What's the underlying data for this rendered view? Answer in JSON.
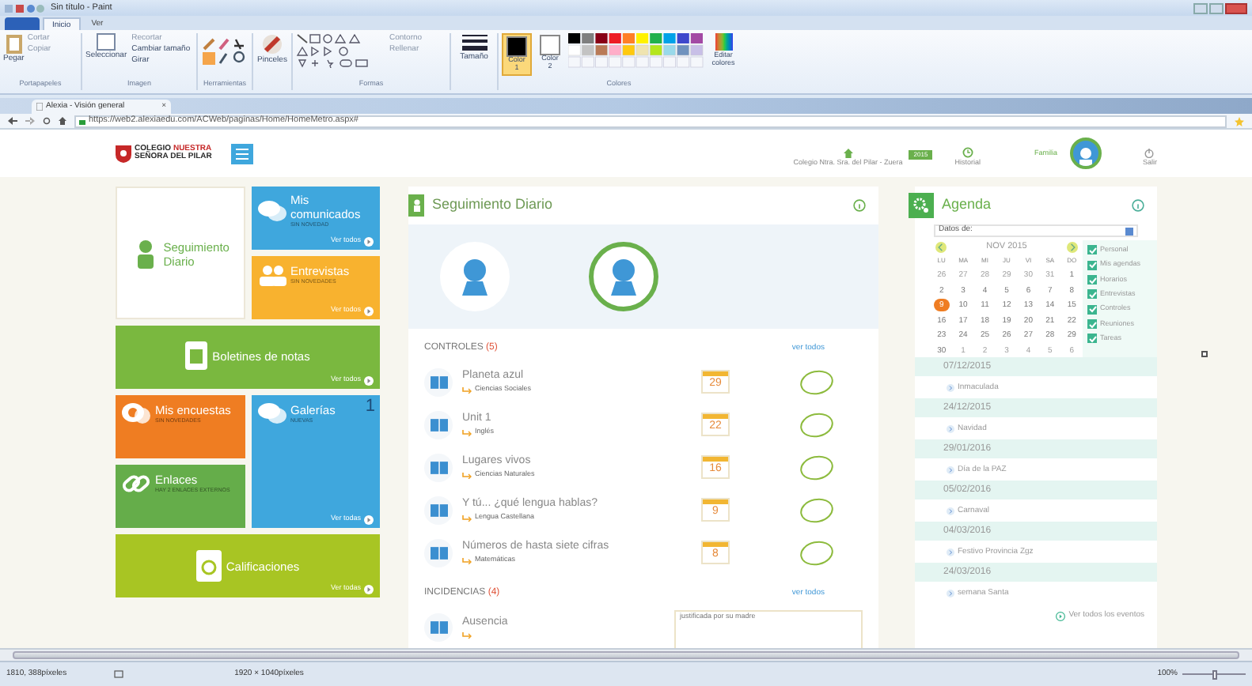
{
  "paint": {
    "title": "Sin título - Paint",
    "tabs": [
      {
        "label": "Inicio",
        "selected": true
      },
      {
        "label": "Ver",
        "selected": false
      }
    ],
    "ribbon": {
      "clipboard": {
        "paste": "Pegar",
        "cut": "Cortar",
        "copy": "Copiar",
        "label": "Portapapeles"
      },
      "image": {
        "select": "Seleccionar",
        "crop": "Recortar",
        "resize": "Cambiar tamaño",
        "rotate": "Girar",
        "label": "Imagen"
      },
      "tools": {
        "label": "Herramientas"
      },
      "brushes": "Pinceles",
      "shapes": {
        "outline": "Contorno",
        "fill": "Rellenar",
        "label": "Formas"
      },
      "size": "Tamaño",
      "colors": {
        "slots": [
          {
            "label": "Color 1",
            "selected": true,
            "color": "#000000"
          },
          {
            "label": "Color 2",
            "selected": false,
            "color": "#ffffff"
          }
        ],
        "edit": "Editar colores",
        "label": "Colores"
      }
    }
  },
  "browser": {
    "tab": {
      "title": "Alexia - Visión general",
      "close": "×"
    },
    "url": "https://web2.alexiaedu.com/ACWeb/paginas/Home/HomeMetro.aspx#"
  },
  "site": {
    "logo": {
      "line1": "COLEGIO",
      "accent": "NUESTRA",
      "line2": "SEÑORA DEL PILAR"
    },
    "header": {
      "school": "Colegio Ntra. Sra. del Pilar - Zuera",
      "year": "2015",
      "history": "Historial",
      "family": "Familia",
      "logout": "Salir"
    }
  },
  "tiles": [
    {
      "kind": "person",
      "title": "Seguimiento Diario",
      "color": "#ffffff"
    },
    {
      "kind": "chat",
      "title": "Mis comunicados",
      "subtitle": "SIN NOVEDAD",
      "link": "Ver todos",
      "color": "#3fa7dd"
    },
    {
      "kind": "people",
      "title": "Entrevistas",
      "subtitle": "SIN NOVEDADES",
      "link": "Ver todos",
      "color": "#f8b22f"
    },
    {
      "kind": "document",
      "title": "Boletines de notas",
      "link": "Ver todos",
      "color": "#7ab83f"
    },
    {
      "kind": "survey",
      "title": "Mis encuestas",
      "subtitle": "SIN NOVEDADES",
      "color": "#ef7d22"
    },
    {
      "kind": "chat",
      "title": "Galerías",
      "subtitle": "NUEVAS",
      "badge": "1",
      "link": "Ver todas",
      "color": "#3fa7dd"
    },
    {
      "kind": "link",
      "title": "Enlaces",
      "subtitle": "HAY 2 ENLACES EXTERNOS",
      "color": "#65ad4a"
    },
    {
      "kind": "certificate",
      "title": "Calificaciones",
      "link": "Ver todas",
      "color": "#a8c523"
    }
  ],
  "seguimiento": {
    "title": "Seguimiento Diario",
    "students": [
      {
        "selected": false
      },
      {
        "selected": true
      }
    ],
    "controles": {
      "title": "CONTROLES",
      "count": "(5)",
      "link": "ver todos",
      "rows": [
        {
          "title": "Planeta azul",
          "subject": "Ciencias Sociales",
          "day": "29"
        },
        {
          "title": "Unit 1",
          "subject": "Inglés",
          "day": "22"
        },
        {
          "title": "Lugares vivos",
          "subject": "Ciencias Naturales",
          "day": "16"
        },
        {
          "title": "Y tú... ¿qué lengua hablas?",
          "subject": "Lengua Castellana",
          "day": "9"
        },
        {
          "title": "Números de hasta siete cifras",
          "subject": "Matemáticas",
          "day": "8"
        }
      ]
    },
    "incidencias": {
      "title": "INCIDENCIAS",
      "count": "(4)",
      "link": "ver todos",
      "rows": [
        {
          "title": "Ausencia",
          "note": "justificada por su madre"
        }
      ]
    }
  },
  "agenda": {
    "title": "Agenda",
    "select": "Datos de:",
    "month": "NOV 2015",
    "weekdays": [
      "LU",
      "MA",
      "MI",
      "JU",
      "VI",
      "SA",
      "DO"
    ],
    "days": [
      {
        "label": "26",
        "in_month": false,
        "selected": false
      },
      {
        "label": "27",
        "in_month": false,
        "selected": false
      },
      {
        "label": "28",
        "in_month": false,
        "selected": false
      },
      {
        "label": "29",
        "in_month": false,
        "selected": false
      },
      {
        "label": "30",
        "in_month": false,
        "selected": false
      },
      {
        "label": "31",
        "in_month": false,
        "selected": false
      },
      {
        "label": "1",
        "in_month": true,
        "selected": false
      },
      {
        "label": "2",
        "in_month": true,
        "selected": false
      },
      {
        "label": "3",
        "in_month": true,
        "selected": false
      },
      {
        "label": "4",
        "in_month": true,
        "selected": false
      },
      {
        "label": "5",
        "in_month": true,
        "selected": false
      },
      {
        "label": "6",
        "in_month": true,
        "selected": false
      },
      {
        "label": "7",
        "in_month": true,
        "selected": false
      },
      {
        "label": "8",
        "in_month": true,
        "selected": false
      },
      {
        "label": "9",
        "in_month": true,
        "selected": true
      },
      {
        "label": "10",
        "in_month": true,
        "selected": false
      },
      {
        "label": "11",
        "in_month": true,
        "selected": false
      },
      {
        "label": "12",
        "in_month": true,
        "selected": false
      },
      {
        "label": "13",
        "in_month": true,
        "selected": false
      },
      {
        "label": "14",
        "in_month": true,
        "selected": false
      },
      {
        "label": "15",
        "in_month": true,
        "selected": false
      },
      {
        "label": "16",
        "in_month": true,
        "selected": false
      },
      {
        "label": "17",
        "in_month": true,
        "selected": false
      },
      {
        "label": "18",
        "in_month": true,
        "selected": false
      },
      {
        "label": "19",
        "in_month": true,
        "selected": false
      },
      {
        "label": "20",
        "in_month": true,
        "selected": false
      },
      {
        "label": "21",
        "in_month": true,
        "selected": false
      },
      {
        "label": "22",
        "in_month": true,
        "selected": false
      },
      {
        "label": "23",
        "in_month": true,
        "selected": false
      },
      {
        "label": "24",
        "in_month": true,
        "selected": false
      },
      {
        "label": "25",
        "in_month": true,
        "selected": false
      },
      {
        "label": "26",
        "in_month": true,
        "selected": false
      },
      {
        "label": "27",
        "in_month": true,
        "selected": false
      },
      {
        "label": "28",
        "in_month": true,
        "selected": false
      },
      {
        "label": "29",
        "in_month": true,
        "selected": false
      },
      {
        "label": "30",
        "in_month": true,
        "selected": false
      },
      {
        "label": "1",
        "in_month": false,
        "selected": false
      },
      {
        "label": "2",
        "in_month": false,
        "selected": false
      },
      {
        "label": "3",
        "in_month": false,
        "selected": false
      },
      {
        "label": "4",
        "in_month": false,
        "selected": false
      },
      {
        "label": "5",
        "in_month": false,
        "selected": false
      },
      {
        "label": "6",
        "in_month": false,
        "selected": false
      }
    ],
    "filters": [
      {
        "label": "Personal",
        "checked": true
      },
      {
        "label": "Mis agendas",
        "checked": true
      },
      {
        "label": "Horarios",
        "checked": true
      },
      {
        "label": "Entrevistas",
        "checked": true
      },
      {
        "label": "Controles",
        "checked": true
      },
      {
        "label": "Reuniones",
        "checked": true
      },
      {
        "label": "Tareas",
        "checked": true
      }
    ],
    "events": [
      {
        "date": "07/12/2015",
        "name": "Inmaculada"
      },
      {
        "date": "24/12/2015",
        "name": "Navidad"
      },
      {
        "date": "29/01/2016",
        "name": "Día de la PAZ"
      },
      {
        "date": "05/02/2016",
        "name": "Carnaval"
      },
      {
        "date": "04/03/2016",
        "name": "Festivo Provincia Zgz"
      },
      {
        "date": "24/03/2016",
        "name": "semana Santa"
      }
    ],
    "all_events": "Ver todos los eventos"
  },
  "status": {
    "position": "1810, 388píxeles",
    "size": "1920 × 1040píxeles",
    "zoom": "100%",
    "zoom_slider": {
      "level": 0.5
    }
  }
}
